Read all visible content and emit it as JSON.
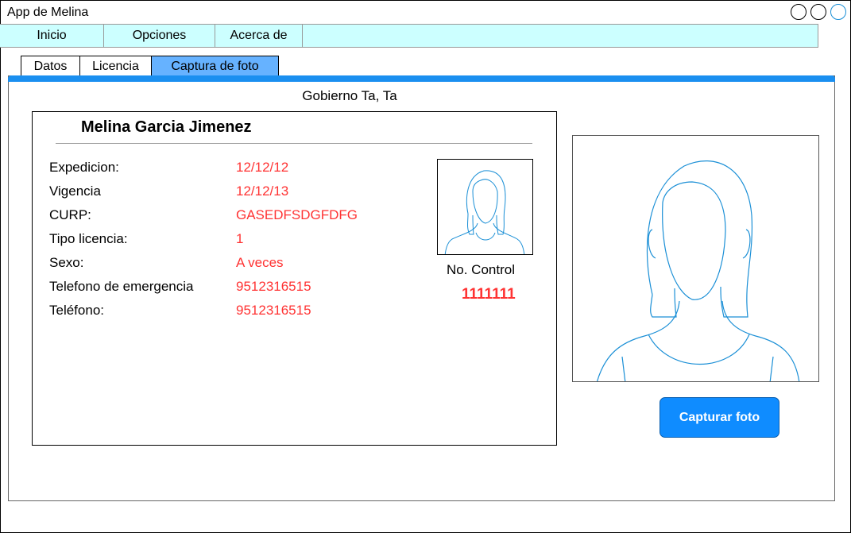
{
  "window": {
    "title": "App de Melina"
  },
  "menu": [
    {
      "label": "Inicio"
    },
    {
      "label": "Opciones"
    },
    {
      "label": "Acerca de"
    }
  ],
  "tabs": [
    {
      "label": "Datos",
      "active": false
    },
    {
      "label": "Licencia",
      "active": false
    },
    {
      "label": "Captura de foto",
      "active": true
    }
  ],
  "panel": {
    "organization": "Gobierno Ta, Ta"
  },
  "card": {
    "name": "Melina Garcia Jimenez",
    "fields": [
      {
        "label": "Expedicion:",
        "value": "12/12/12"
      },
      {
        "label": "Vigencia",
        "value": "12/12/13"
      },
      {
        "label": "CURP:",
        "value": "GASEDFSDGFDFG"
      },
      {
        "label": "Tipo licencia:",
        "value": "1"
      },
      {
        "label": "Sexo:",
        "value": "A veces"
      },
      {
        "label": "Telefono de emergencia",
        "value": "9512316515"
      },
      {
        "label": "Teléfono:",
        "value": "9512316515"
      }
    ],
    "control_label": "No. Control",
    "control_value": "1111111"
  },
  "actions": {
    "capture_label": "Capturar foto"
  },
  "colors": {
    "menubar": "#ccffff",
    "active_tab": "#66b2ff",
    "accent": "#1a8ff0",
    "value_text": "#ff3333",
    "button": "#0f8cff"
  }
}
